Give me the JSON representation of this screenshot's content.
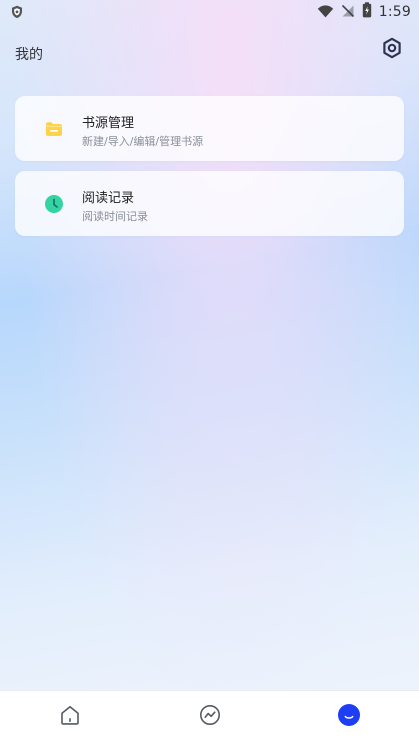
{
  "status_bar": {
    "time": "1:59"
  },
  "header": {
    "title": "我的"
  },
  "cards": [
    {
      "title": "书源管理",
      "subtitle": "新建/导入/编辑/管理书源"
    },
    {
      "title": "阅读记录",
      "subtitle": "阅读时间记录"
    }
  ],
  "icons": {
    "status_left": "shield-icon",
    "wifi": "wifi-icon",
    "signal": "signal-off-icon",
    "battery": "battery-charging-icon",
    "settings": "gear-icon",
    "book_source": "folder-icon",
    "reading_history": "clock-icon",
    "nav_home": "home-icon",
    "nav_trend": "trend-icon",
    "nav_me": "profile-icon"
  },
  "colors": {
    "folder": "#FFD247",
    "clock": "#34D3A2",
    "active_tab": "#1D3EF2",
    "settings_icon": "#2E3550"
  }
}
